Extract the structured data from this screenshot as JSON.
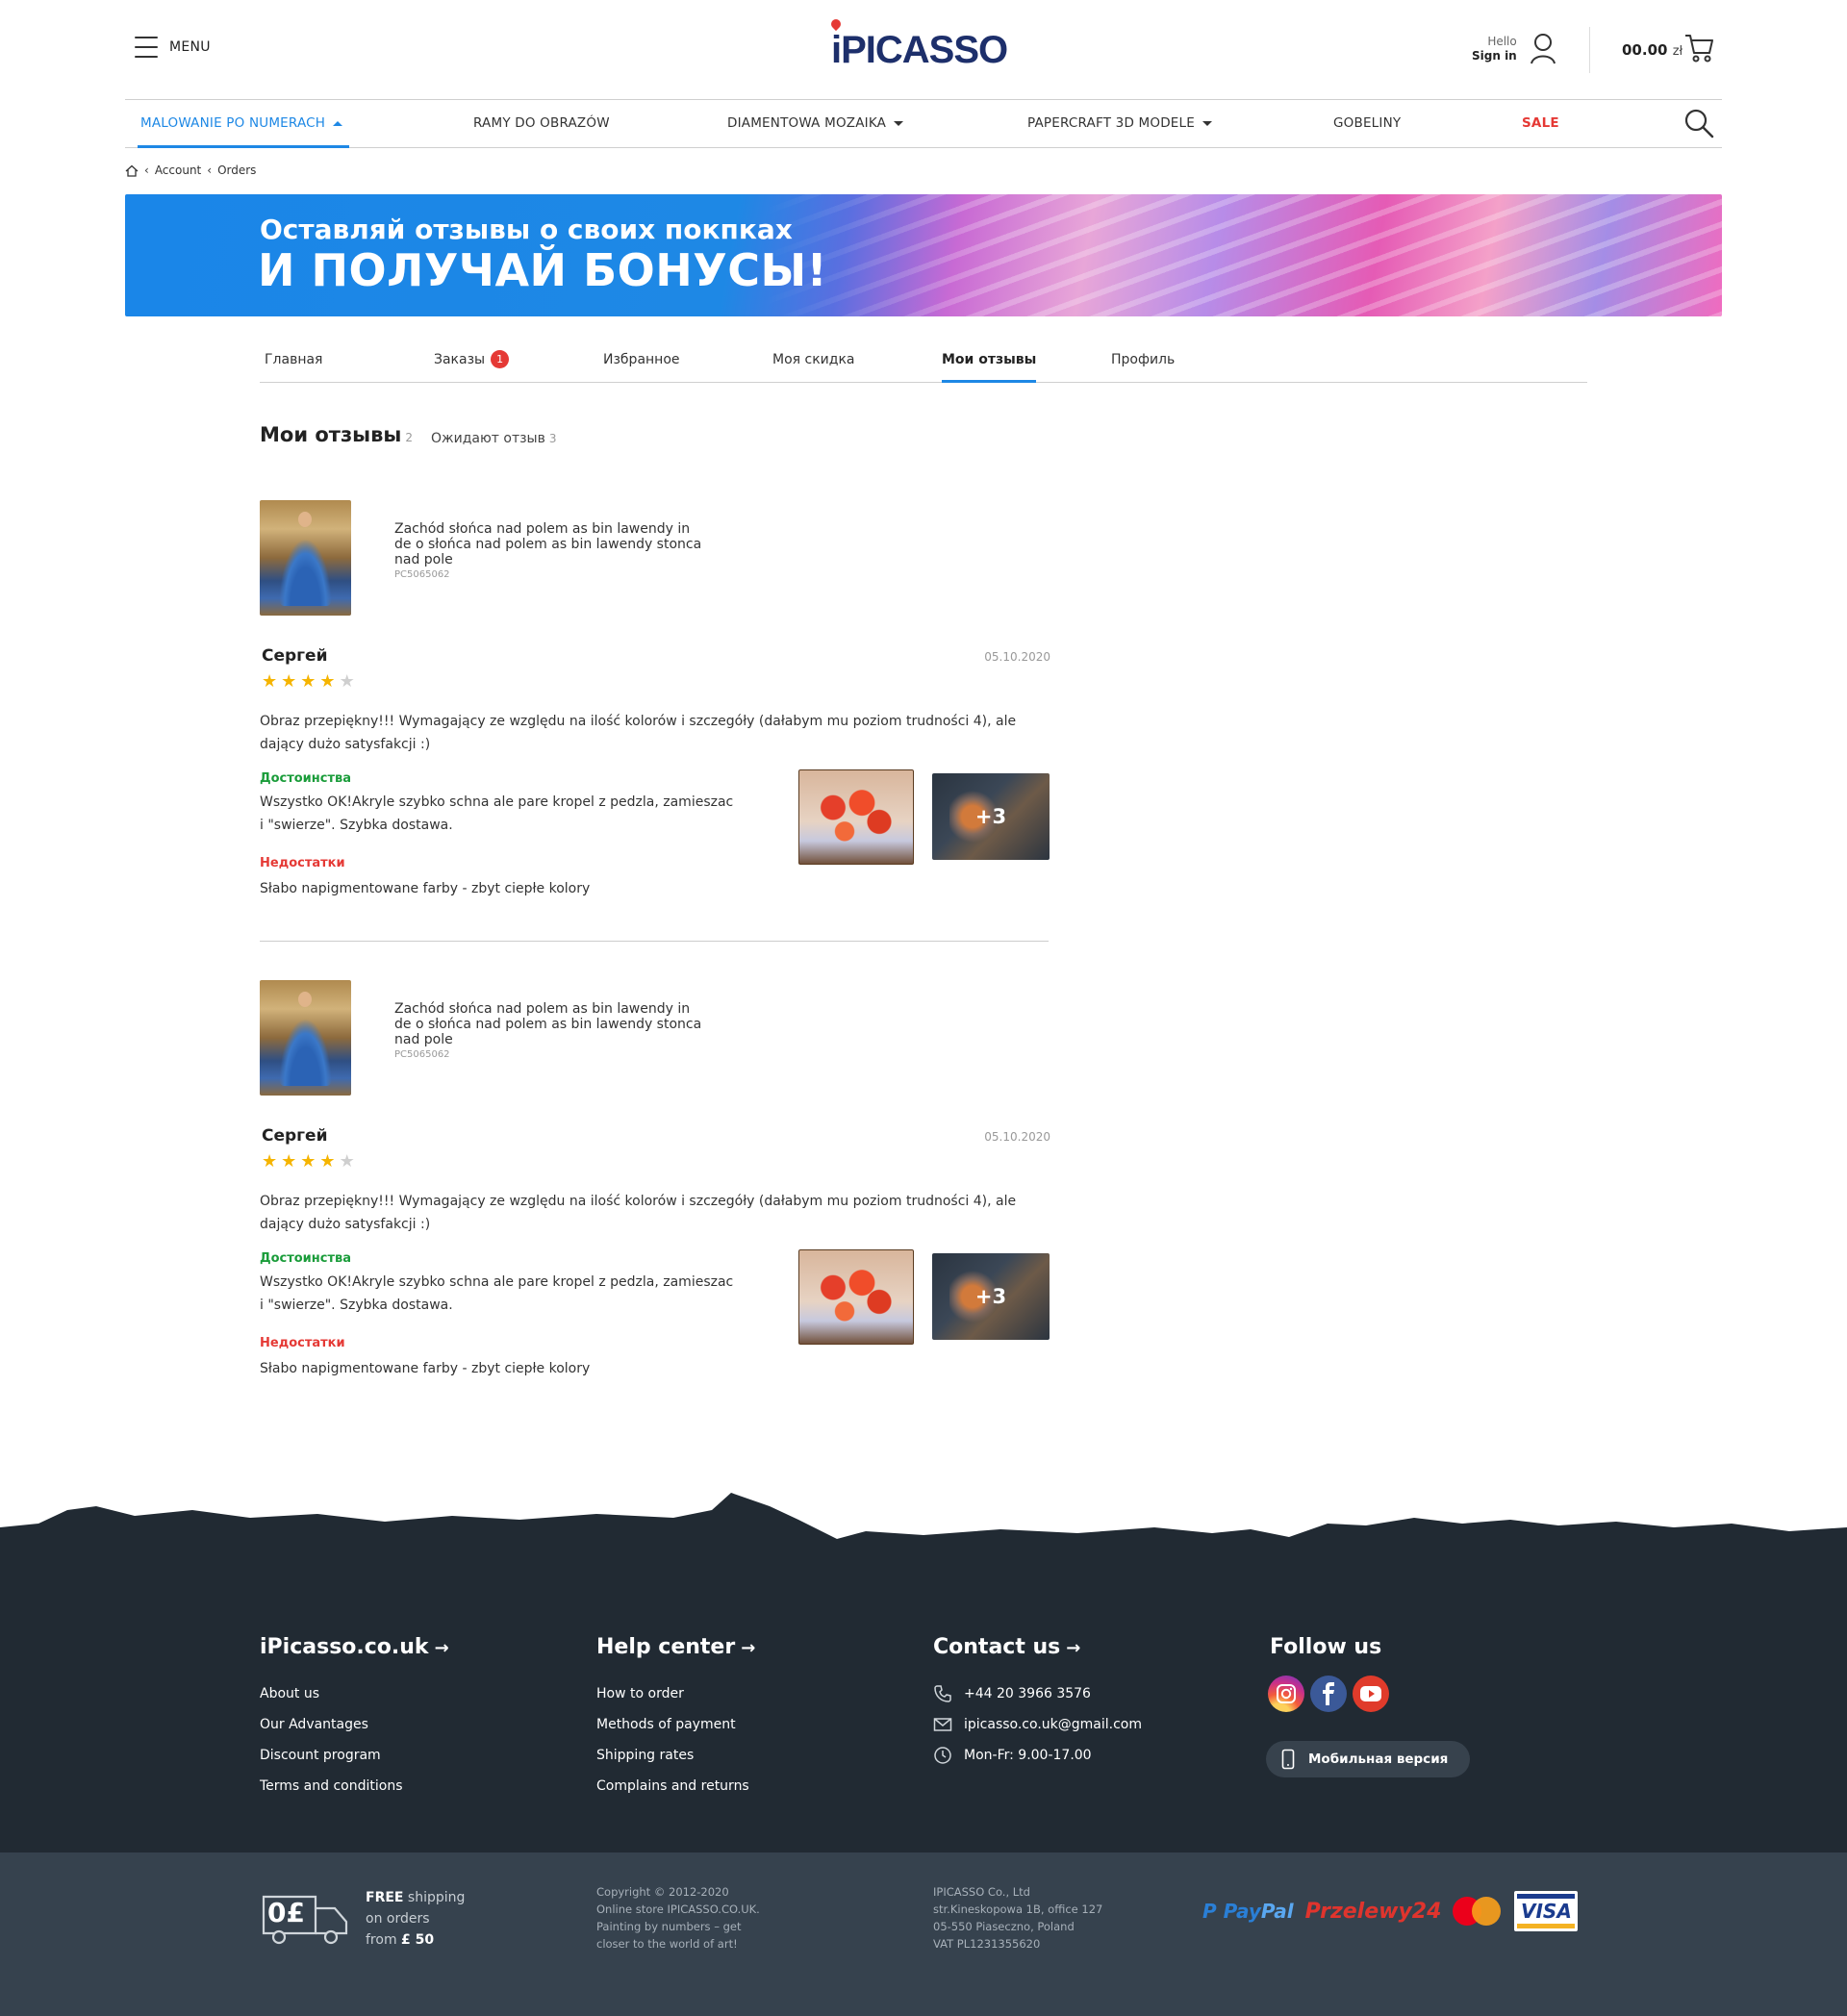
{
  "header": {
    "menu_label": "MENU",
    "logo_text": "iPICASSO",
    "hello": "Hello",
    "sign_in": "Sign in",
    "cart_amount": "00.00",
    "cart_currency": "zł"
  },
  "nav": {
    "items": [
      {
        "label": "MALOWANIE PO NUMERACH",
        "has_caret": true,
        "active": true
      },
      {
        "label": "RAMY DO OBRAZÓW",
        "has_caret": false
      },
      {
        "label": "DIAMENTOWA MOZAIKA",
        "has_caret": true
      },
      {
        "label": "PAPERCRAFT 3D MODELE",
        "has_caret": true
      },
      {
        "label": "GOBELINY",
        "has_caret": false
      },
      {
        "label": "SALE",
        "has_caret": false
      }
    ]
  },
  "breadcrumb": {
    "items": [
      "Account",
      "Orders"
    ]
  },
  "banner": {
    "line1": "Оставляй отзывы о своих покпках",
    "line2": "И ПОЛУЧАЙ БОНУСЫ!"
  },
  "tabs": {
    "items": [
      {
        "label": "Главная"
      },
      {
        "label": "Заказы",
        "badge": "1"
      },
      {
        "label": "Избранное"
      },
      {
        "label": "Моя скидка"
      },
      {
        "label": "Мои отзывы",
        "active": true
      },
      {
        "label": "Профиль"
      }
    ]
  },
  "section": {
    "title": "Мои отзывы",
    "title_count": "2",
    "pending_label": "Ожидают отзыв",
    "pending_count": "3"
  },
  "reviews": [
    {
      "product_name": "Zachód słońca nad polem as bin lawendy in de o słońca nad polem as bin lawendy stonca nad pole",
      "sku": "PC5065062",
      "author": "Сергей",
      "date": "05.10.2020",
      "rating": 4,
      "rating_max": 5,
      "text": "Obraz przepiękny!!! Wymagający ze względu na ilość kolorów i szczegóły (dałabym mu poziom trudności 4), ale dający dużo satysfakcji :)",
      "pros_label": "Достоинства",
      "pros": "Wszystko OK!Akryle szybko schna ale pare kropel z pedzla, zamieszac i \"swierze\". Szybka dostawa.",
      "cons_label": "Недостатки",
      "cons": "Słabo napigmentowane farby - zbyt ciepłe kolory",
      "more_photos": "+3"
    },
    {
      "product_name": "Zachód słońca nad polem as bin lawendy in de o słońca nad polem as bin lawendy stonca nad pole",
      "sku": "PC5065062",
      "author": "Сергей",
      "date": "05.10.2020",
      "rating": 4,
      "rating_max": 5,
      "text": "Obraz przepiękny!!! Wymagający ze względu na ilość kolorów i szczegóły (dałabym mu poziom trudności 4), ale dający dużo satysfakcji :)",
      "pros_label": "Достоинства",
      "pros": "Wszystko OK!Akryle szybko schna ale pare kropel z pedzla, zamieszac i \"swierze\". Szybka dostawa.",
      "cons_label": "Недостатки",
      "cons": "Słabo napigmentowane farby - zbyt ciepłe kolory",
      "more_photos": "+3"
    }
  ],
  "footer": {
    "col1": {
      "title": "iPicasso.co.uk",
      "links": [
        "About us",
        "Our Advantages",
        "Discount program",
        "Terms and conditions"
      ]
    },
    "col2": {
      "title": "Help center",
      "links": [
        "How to order",
        "Methods of payment",
        "Shipping rates",
        "Complains and returns"
      ]
    },
    "col3": {
      "title": "Contact us",
      "phone": "+44 20 3966 3576",
      "email": "ipicasso.co.uk@gmail.com",
      "hours": "Mon-Fr: 9.00-17.00"
    },
    "col4": {
      "title": "Follow us",
      "mobile_label": "Мобильная версия"
    },
    "ship": {
      "icon_text": "0£",
      "free": "FREE",
      "line1_rest": " shipping",
      "line2": "on orders",
      "line3_pre": "from ",
      "line3_amount": "£ 50"
    },
    "copyright": [
      "Copyright © 2012-2020",
      "Online store IPICASSO.CO.UK.",
      "Painting by numbers – get",
      "closer to the world of art!"
    ],
    "company": [
      "IPICASSO Co., Ltd",
      "str.Kineskopowa 1B, office 127",
      "05-550 Piaseczno, Poland",
      "VAT PL1231355620"
    ],
    "payments": {
      "paypal_a": "Pay",
      "paypal_b": "Pal",
      "p24": "Przelewy24",
      "mc": "mastercard",
      "visa": "VISA"
    }
  }
}
